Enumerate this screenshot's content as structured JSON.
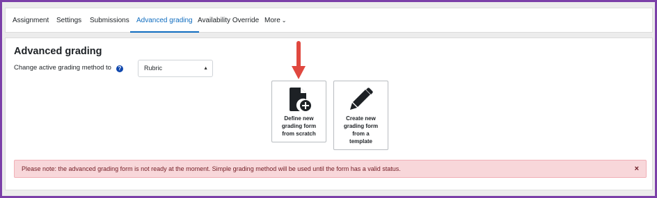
{
  "tabs": [
    {
      "label": "Assignment"
    },
    {
      "label": "Settings"
    },
    {
      "label": "Submissions"
    },
    {
      "label": "Advanced grading",
      "active": true
    },
    {
      "label": "Availability Override"
    },
    {
      "label": "More"
    }
  ],
  "page": {
    "title": "Advanced grading",
    "method_label": "Change active grading method to",
    "method_selected": "Rubric"
  },
  "actions": {
    "define_new": "Define new\ngrading form\nfrom scratch",
    "from_template": "Create new\ngrading form\nfrom a\ntemplate"
  },
  "alert": {
    "text": "Please note: the advanced grading form is not ready at the moment. Simple grading method will be used until the form has a valid status.",
    "close_glyph": "×"
  },
  "colors": {
    "frame": "#7b3fa8",
    "accent": "#0f6cbf",
    "arrow": "#e0483f",
    "alert_bg": "#f8d7da",
    "alert_text": "#721c24"
  },
  "icons": {
    "help": "question-circle-icon",
    "define": "file-plus-icon",
    "template": "pencil-icon",
    "close": "close-icon",
    "more": "chevron-down-icon"
  }
}
